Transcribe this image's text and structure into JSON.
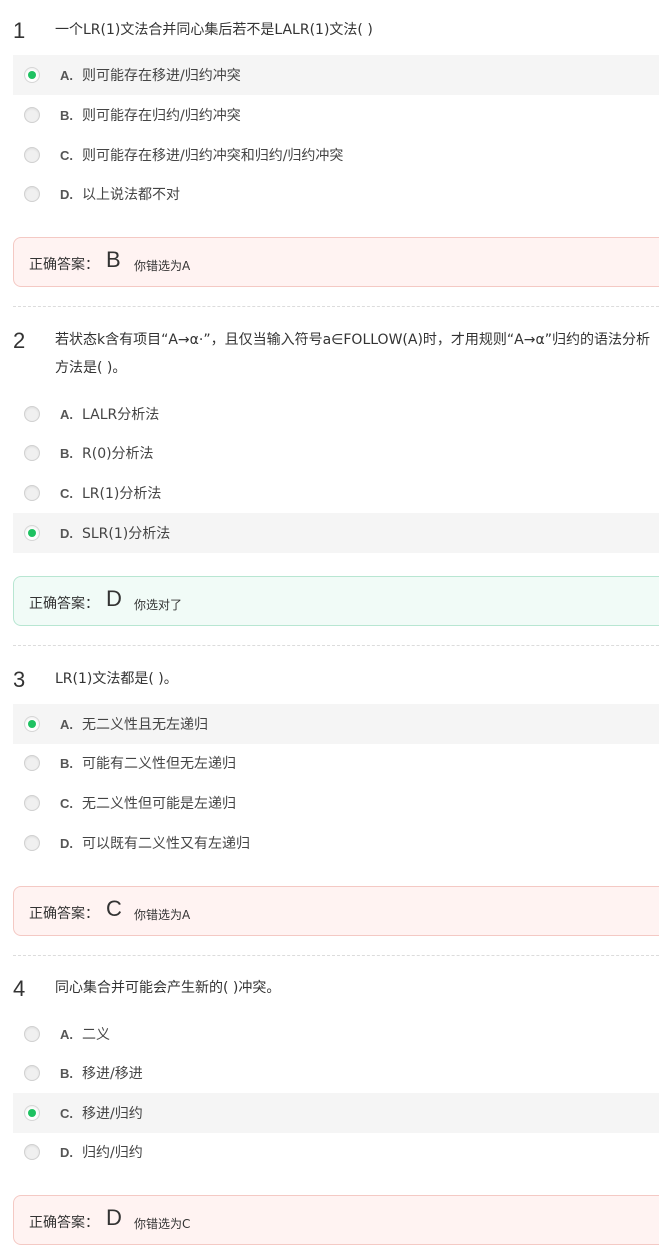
{
  "questions": [
    {
      "number": "1",
      "stem": "一个LR(1)文法合并同心集后若不是LALR(1)文法(    )",
      "options": [
        {
          "letter": "A.",
          "text": "则可能存在移进/归约冲突",
          "selected": true
        },
        {
          "letter": "B.",
          "text": "则可能存在归约/归约冲突",
          "selected": false
        },
        {
          "letter": "C.",
          "text": "则可能存在移进/归约冲突和归约/归约冲突",
          "selected": false
        },
        {
          "letter": "D.",
          "text": "以上说法都不对",
          "selected": false
        }
      ],
      "answer_label": "正确答案：",
      "correct_answer": "B",
      "result": "你错选为A",
      "is_correct": false
    },
    {
      "number": "2",
      "stem": "若状态k含有项目“A→α·”，且仅当输入符号a∈FOLLOW(A)时，才用规则“A→α”归约的语法分析方法是( )。",
      "options": [
        {
          "letter": "A.",
          "text": "LALR分析法",
          "selected": false
        },
        {
          "letter": "B.",
          "text": "R(0)分析法",
          "selected": false
        },
        {
          "letter": "C.",
          "text": "LR(1)分析法",
          "selected": false
        },
        {
          "letter": "D.",
          "text": "SLR(1)分析法",
          "selected": true
        }
      ],
      "answer_label": "正确答案：",
      "correct_answer": "D",
      "result": "你选对了",
      "is_correct": true
    },
    {
      "number": "3",
      "stem": "LR(1)文法都是( )。",
      "options": [
        {
          "letter": "A.",
          "text": "无二义性且无左递归",
          "selected": true
        },
        {
          "letter": "B.",
          "text": "可能有二义性但无左递归",
          "selected": false
        },
        {
          "letter": "C.",
          "text": "无二义性但可能是左递归",
          "selected": false
        },
        {
          "letter": "D.",
          "text": "可以既有二义性又有左递归",
          "selected": false
        }
      ],
      "answer_label": "正确答案：",
      "correct_answer": "C",
      "result": "你错选为A",
      "is_correct": false
    },
    {
      "number": "4",
      "stem": "同心集合并可能会产生新的( )冲突。",
      "options": [
        {
          "letter": "A.",
          "text": "二义",
          "selected": false
        },
        {
          "letter": "B.",
          "text": "移进/移进",
          "selected": false
        },
        {
          "letter": "C.",
          "text": "移进/归约",
          "selected": true
        },
        {
          "letter": "D.",
          "text": "归约/归约",
          "selected": false
        }
      ],
      "answer_label": "正确答案：",
      "correct_answer": "D",
      "result": "你错选为C",
      "is_correct": false
    }
  ],
  "colors": {
    "radio_selected": "#1fc262",
    "wrong_bg": "#fff3f2",
    "wrong_border": "#f4c9c4",
    "right_bg": "#f1fbf7",
    "right_border": "#b8e6d2"
  }
}
